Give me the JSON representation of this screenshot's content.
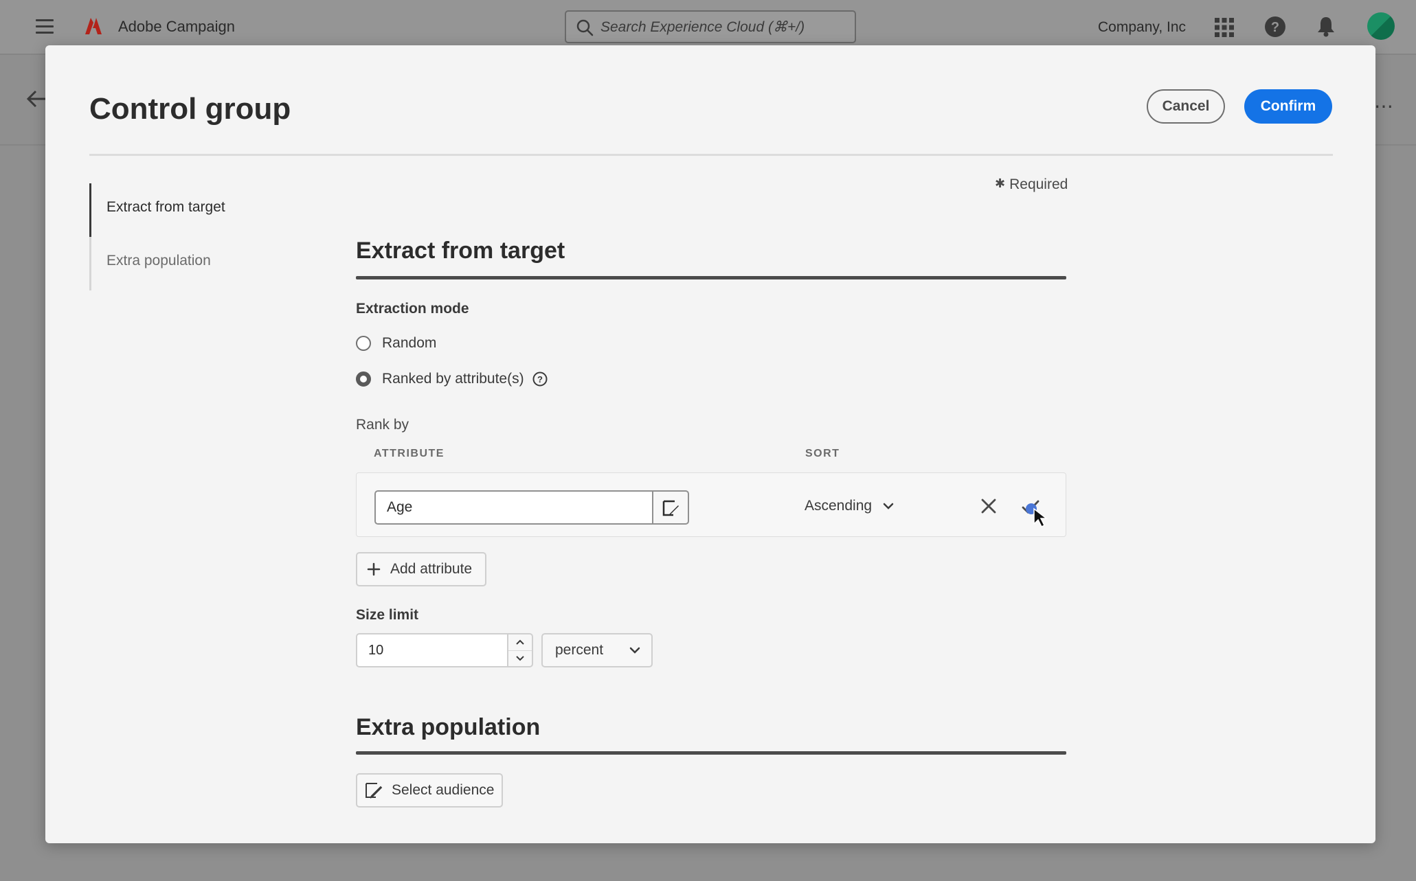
{
  "topbar": {
    "app_name": "Adobe Campaign",
    "search_placeholder": "Search Experience Cloud (⌘+/)",
    "company": "Company, Inc",
    "brand_color": "#c8281e"
  },
  "modal": {
    "title": "Control group",
    "cancel_label": "Cancel",
    "confirm_label": "Confirm",
    "required_label": "Required",
    "nav": [
      {
        "label": "Extract from target",
        "active": true
      },
      {
        "label": "Extra population",
        "active": false
      }
    ],
    "extract": {
      "title": "Extract from target",
      "mode_label": "Extraction mode",
      "options": [
        {
          "label": "Random",
          "checked": false
        },
        {
          "label": "Ranked by attribute(s)",
          "checked": true
        }
      ],
      "rank_by_label": "Rank by",
      "col_attribute": "ATTRIBUTE",
      "col_sort": "SORT",
      "row": {
        "attribute": "Age",
        "sort": "Ascending"
      },
      "add_attribute_label": "Add attribute",
      "size_limit_label": "Size limit",
      "size_value": "10",
      "size_unit": "percent"
    },
    "extra": {
      "title": "Extra population",
      "select_audience_label": "Select audience"
    }
  },
  "colors": {
    "accent": "#1473e6",
    "overlay": "#8f8f8f"
  }
}
